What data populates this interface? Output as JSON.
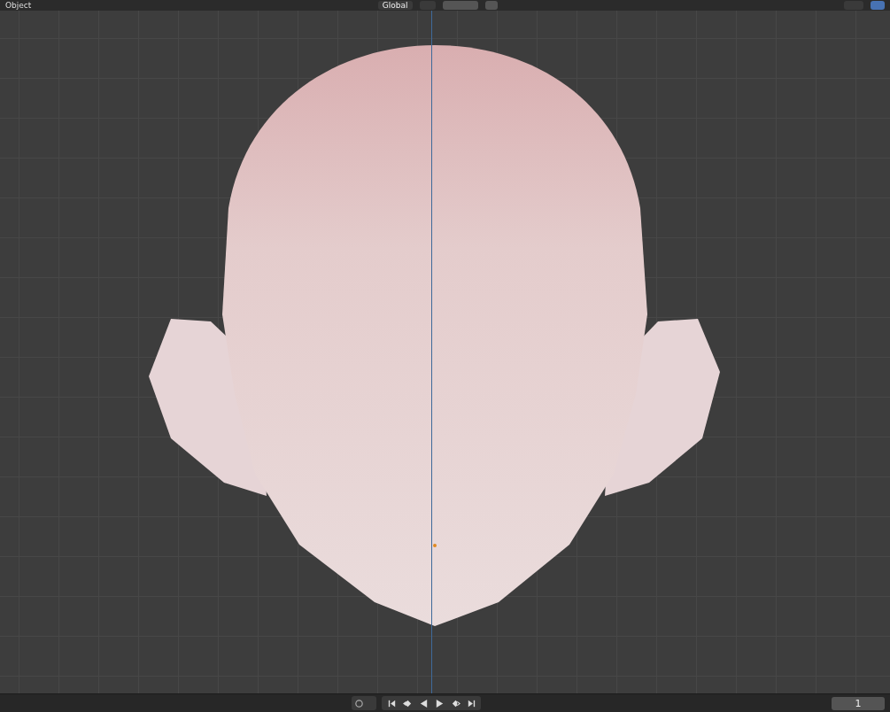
{
  "header": {
    "mode": "Object",
    "orientation": "Global",
    "overlays_on": true
  },
  "timeline": {
    "current_frame": "1",
    "auto_keying_on": false
  }
}
